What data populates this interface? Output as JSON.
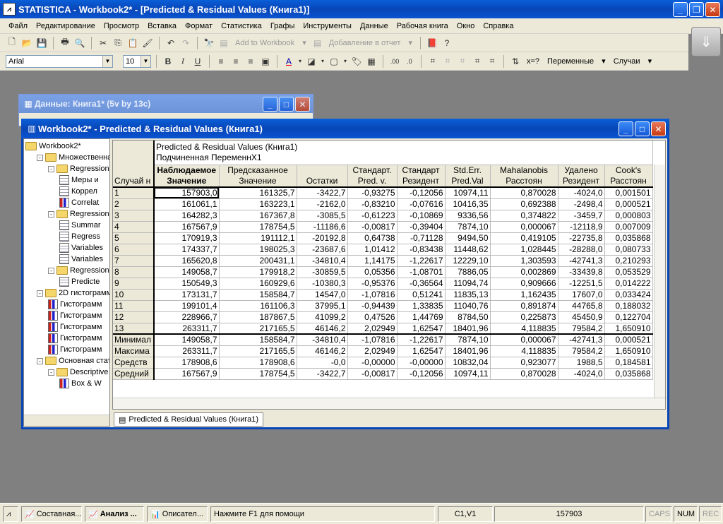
{
  "app": {
    "title": "STATISTICA - Workbook2* - [Predicted & Residual Values (Книга1)]"
  },
  "menu": [
    "Файл",
    "Редактирование",
    "Просмотр",
    "Вставка",
    "Формат",
    "Статистика",
    "Графы",
    "Инструменты",
    "Данные",
    "Рабочая книга",
    "Окно",
    "Справка"
  ],
  "toolbar": {
    "add_to_workbook": "Add to Workbook",
    "add_to_report": "Добавление в отчет",
    "font": "Arial",
    "size": "10",
    "bold": "B",
    "italic": "I",
    "underline": "U",
    "variables": "Переменные",
    "cases": "Случаи",
    "var_sym": "x=?"
  },
  "data_window": {
    "title": "Данные: Книга1* (5v by 13c)"
  },
  "workbook": {
    "title": "Workbook2* - Predicted & Residual Values (Книга1)"
  },
  "tree": [
    {
      "label": "Workbook2*",
      "indent": 0,
      "kind": "folder",
      "pm": ""
    },
    {
      "label": "Множественная",
      "indent": 1,
      "kind": "folder",
      "pm": "-"
    },
    {
      "label": "Regression с",
      "indent": 2,
      "kind": "folder",
      "pm": "-"
    },
    {
      "label": "Меры и",
      "indent": 3,
      "kind": "doc",
      "pm": ""
    },
    {
      "label": "Коррел",
      "indent": 3,
      "kind": "doc",
      "pm": ""
    },
    {
      "label": "Correlat",
      "indent": 3,
      "kind": "chart",
      "pm": ""
    },
    {
      "label": "Regression r",
      "indent": 2,
      "kind": "folder",
      "pm": "-"
    },
    {
      "label": "Summar",
      "indent": 3,
      "kind": "doc",
      "pm": ""
    },
    {
      "label": "Regress",
      "indent": 3,
      "kind": "doc",
      "pm": ""
    },
    {
      "label": "Variables",
      "indent": 3,
      "kind": "doc",
      "pm": ""
    },
    {
      "label": "Variables",
      "indent": 3,
      "kind": "doc",
      "pm": ""
    },
    {
      "label": "Regression r",
      "indent": 2,
      "kind": "folder",
      "pm": "-"
    },
    {
      "label": "Predicte",
      "indent": 3,
      "kind": "doc",
      "pm": ""
    },
    {
      "label": "2D гистограммы",
      "indent": 1,
      "kind": "folder",
      "pm": "-"
    },
    {
      "label": "Гистограмм",
      "indent": 2,
      "kind": "chart",
      "pm": ""
    },
    {
      "label": "Гистограмм",
      "indent": 2,
      "kind": "chart",
      "pm": ""
    },
    {
      "label": "Гистограмм",
      "indent": 2,
      "kind": "chart",
      "pm": ""
    },
    {
      "label": "Гистограмм",
      "indent": 2,
      "kind": "chart",
      "pm": ""
    },
    {
      "label": "Гистограмм",
      "indent": 2,
      "kind": "chart",
      "pm": ""
    },
    {
      "label": "Основная стати",
      "indent": 1,
      "kind": "folder",
      "pm": "-"
    },
    {
      "label": "Descriptive s",
      "indent": 2,
      "kind": "folder",
      "pm": "-"
    },
    {
      "label": "Box & W",
      "indent": 3,
      "kind": "chart",
      "pm": ""
    }
  ],
  "sheet": {
    "title1": "Predicted & Residual Values (Книга1)",
    "title2": "Подчиненная ПеременнX1",
    "rowheader_title": "Случай н",
    "columns": [
      [
        "Наблюдаемое",
        "Значение"
      ],
      [
        "Предсказанное",
        "Значение"
      ],
      [
        "",
        "Остатки"
      ],
      [
        "Стандарт.",
        "Pred. v."
      ],
      [
        "Стандарт",
        "Резидент"
      ],
      [
        "Std.Err.",
        "Pred.Val"
      ],
      [
        "Mahalanobis",
        "Расстоян"
      ],
      [
        "Удалено",
        "Резидент"
      ],
      [
        "Cook's",
        "Расстоян"
      ]
    ],
    "rows": [
      [
        "1",
        "157903,0",
        "161325,7",
        "-3422,7",
        "-0,93275",
        "-0,12056",
        "10974,11",
        "0,870028",
        "-4024,0",
        "0,001501"
      ],
      [
        "2",
        "161061,1",
        "163223,1",
        "-2162,0",
        "-0,83210",
        "-0,07616",
        "10416,35",
        "0,692388",
        "-2498,4",
        "0,000521"
      ],
      [
        "3",
        "164282,3",
        "167367,8",
        "-3085,5",
        "-0,61223",
        "-0,10869",
        "9336,56",
        "0,374822",
        "-3459,7",
        "0,000803"
      ],
      [
        "4",
        "167567,9",
        "178754,5",
        "-11186,6",
        "-0,00817",
        "-0,39404",
        "7874,10",
        "0,000067",
        "-12118,9",
        "0,007009"
      ],
      [
        "5",
        "170919,3",
        "191112,1",
        "-20192,8",
        "0,64738",
        "-0,71128",
        "9494,50",
        "0,419105",
        "-22735,8",
        "0,035868"
      ],
      [
        "6",
        "174337,7",
        "198025,3",
        "-23687,6",
        "1,01412",
        "-0,83438",
        "11448,62",
        "1,028445",
        "-28288,0",
        "0,080733"
      ],
      [
        "7",
        "165620,8",
        "200431,1",
        "-34810,4",
        "1,14175",
        "-1,22617",
        "12229,10",
        "1,303593",
        "-42741,3",
        "0,210293"
      ],
      [
        "8",
        "149058,7",
        "179918,2",
        "-30859,5",
        "0,05356",
        "-1,08701",
        "7886,05",
        "0,002869",
        "-33439,8",
        "0,053529"
      ],
      [
        "9",
        "150549,3",
        "160929,6",
        "-10380,3",
        "-0,95376",
        "-0,36564",
        "11094,74",
        "0,909666",
        "-12251,5",
        "0,014222"
      ],
      [
        "10",
        "173131,7",
        "158584,7",
        "14547,0",
        "-1,07816",
        "0,51241",
        "11835,13",
        "1,162435",
        "17607,0",
        "0,033424"
      ],
      [
        "11",
        "199101,4",
        "161106,3",
        "37995,1",
        "-0,94439",
        "1,33835",
        "11040,76",
        "0,891874",
        "44765,8",
        "0,188032"
      ],
      [
        "12",
        "228966,7",
        "187867,5",
        "41099,2",
        "0,47526",
        "1,44769",
        "8784,50",
        "0,225873",
        "45450,9",
        "0,122704"
      ],
      [
        "13",
        "263311,7",
        "217165,5",
        "46146,2",
        "2,02949",
        "1,62547",
        "18401,96",
        "4,118835",
        "79584,2",
        "1,650910"
      ]
    ],
    "summary": [
      [
        "Минимал",
        "149058,7",
        "158584,7",
        "-34810,4",
        "-1,07816",
        "-1,22617",
        "7874,10",
        "0,000067",
        "-42741,3",
        "0,000521"
      ],
      [
        "Максима",
        "263311,7",
        "217165,5",
        "46146,2",
        "2,02949",
        "1,62547",
        "18401,96",
        "4,118835",
        "79584,2",
        "1,650910"
      ],
      [
        "Средств",
        "178908,6",
        "178908,6",
        "-0,0",
        "-0,00000",
        "-0,00000",
        "10832,04",
        "0,923077",
        "1988,5",
        "0,184581"
      ],
      [
        "Средний",
        "167567,9",
        "178754,5",
        "-3422,7",
        "-0,00817",
        "-0,12056",
        "10974,11",
        "0,870028",
        "-4024,0",
        "0,035868"
      ]
    ],
    "tab": "Predicted & Residual Values (Книга1)"
  },
  "status": {
    "task1": "Составная...",
    "task2": "Анализ ...",
    "task3": "Описател...",
    "help": "Нажмите F1 для помощи",
    "cell": "C1,V1",
    "value": "157903",
    "caps": "CAPS",
    "num": "NUM",
    "rec": "REC"
  }
}
